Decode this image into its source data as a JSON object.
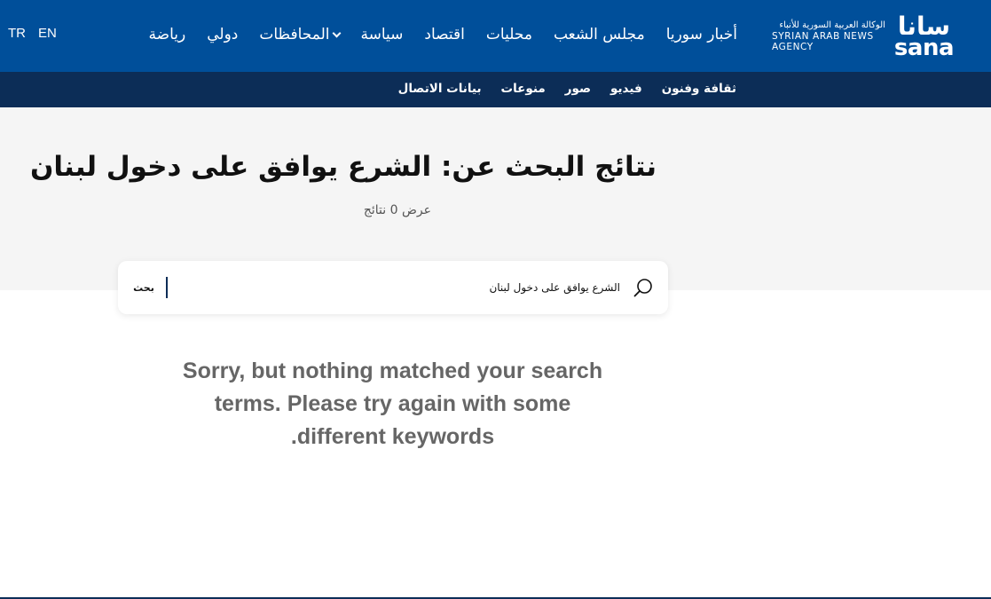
{
  "header": {
    "logo": {
      "text_ar": "الوكالة العربية السورية للأنباء",
      "text_en": "SYRIAN ARAB NEWS AGENCY",
      "mark_ar": "سانا",
      "mark_en": "sana"
    },
    "nav": [
      {
        "label": "أخبار سوريا"
      },
      {
        "label": "مجلس الشعب"
      },
      {
        "label": "محليات"
      },
      {
        "label": "اقتصاد"
      },
      {
        "label": "سياسة"
      },
      {
        "label": "المحافظات",
        "dropdown": true
      },
      {
        "label": "دولي"
      },
      {
        "label": "رياضة"
      }
    ],
    "languages": [
      "TR",
      "EN"
    ],
    "subnav": [
      {
        "label": "ثقافة وفنون"
      },
      {
        "label": "فيديو"
      },
      {
        "label": "صور"
      },
      {
        "label": "منوعات"
      },
      {
        "label": "بيانات الاتصال"
      }
    ],
    "colors": {
      "topbar": "#004f9a",
      "subbar": "#0c2d57"
    }
  },
  "search_results": {
    "title": "نتائج البحث عن: الشرع يوافق على دخول لبنان",
    "count_text": "عرض 0 نتائج"
  },
  "search": {
    "value": "الشرع يوافق على دخول لبنان",
    "button_label": "بحث",
    "icon": "search-icon"
  },
  "empty_message": "Sorry, but nothing matched your search terms. Please try again with some different keywords."
}
